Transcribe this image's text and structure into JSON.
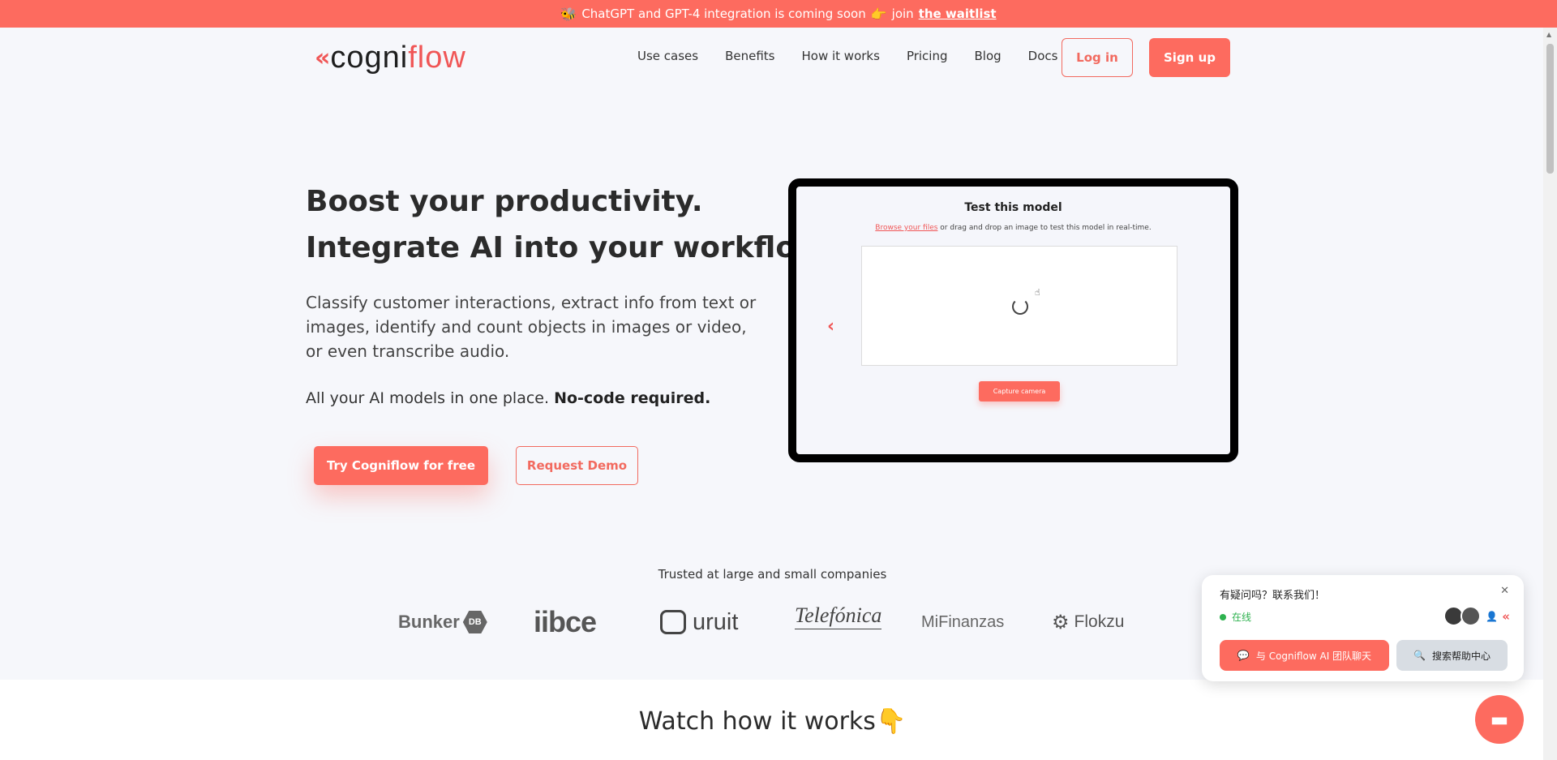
{
  "banner": {
    "lead_icon": "🐝",
    "text": "ChatGPT and GPT-4 integration is coming soon",
    "point_icon": "👉",
    "join": "join",
    "link": "the waitlist"
  },
  "header": {
    "logo_mark": "«",
    "logo_word_a": "cogni",
    "logo_word_b": "flow",
    "nav": [
      "Use cases",
      "Benefits",
      "How it works",
      "Pricing",
      "Blog",
      "Docs"
    ],
    "login": "Log in",
    "signup": "Sign up"
  },
  "hero": {
    "title_line1": "Boost your productivity.",
    "title_line2": "Integrate AI into your workflow.",
    "description": "Classify customer interactions, extract info from text or images, identify and count objects in images or video, or even transcribe audio.",
    "tagline_lead": "All your AI models in one place.",
    "tagline_bold": "No-code required.",
    "cta_primary": "Try Cogniflow for free",
    "cta_secondary": "Request Demo"
  },
  "demo": {
    "title": "Test this model",
    "browse_link": "Browse your files",
    "subtitle_rest": "or drag and drop an image to test this model in real-time.",
    "capture_button": "Capture camera",
    "prev_icon": "‹"
  },
  "trusted": {
    "heading": "Trusted at large and small companies",
    "logos": {
      "bunker": "Bunker",
      "bunker_badge": "DB",
      "iibce": "iibce",
      "uruit": "uruit",
      "telefonica": "Telefónica",
      "mifinanzas": "MiFinanzas",
      "flokzu": "Flokzu"
    }
  },
  "watch": {
    "heading": "Watch how it works",
    "emoji": "👇"
  },
  "chat_widget": {
    "question": "有疑问吗？联系我们！",
    "status": "在线",
    "chat_button": "与 Cogniflow AI 团队聊天",
    "help_button": "搜索帮助中心",
    "close_icon": "✕"
  },
  "colors": {
    "brand": "#fd6b5f",
    "status_online": "#2eb24f"
  }
}
